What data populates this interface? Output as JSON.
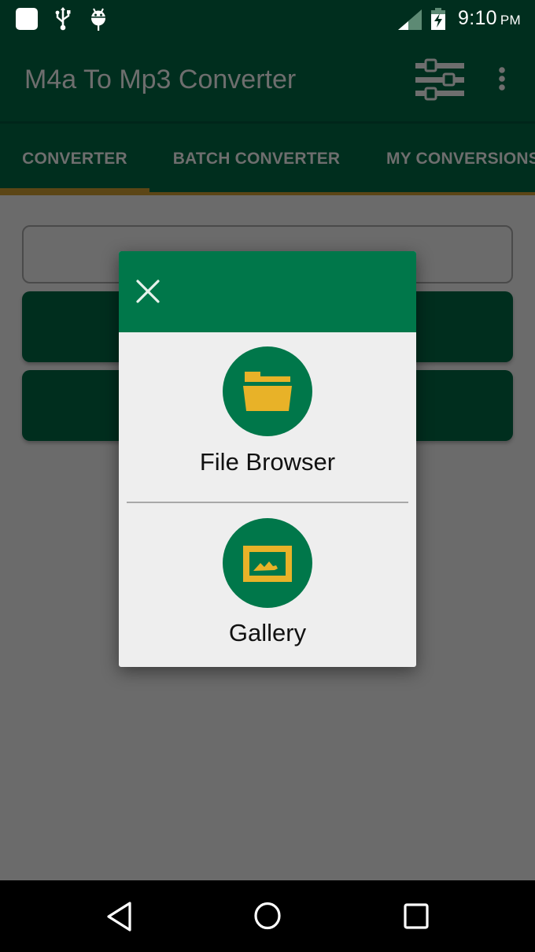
{
  "status_bar": {
    "time": "9:10",
    "ampm": "PM",
    "icons": [
      "notification-square-icon",
      "usb-icon",
      "android-debug-icon",
      "cell-signal-icon",
      "battery-charging-icon"
    ]
  },
  "app_bar": {
    "title": "M4a To Mp3 Converter",
    "actions": [
      "tune-icon",
      "more-vert-icon"
    ]
  },
  "tabs": [
    {
      "label": "CONVERTER",
      "active": true
    },
    {
      "label": "BATCH CONVERTER",
      "active": false
    },
    {
      "label": "MY CONVERSIONS",
      "active": false
    }
  ],
  "colors": {
    "primary_dark": "#002e1e",
    "dialog_green": "#00774a",
    "accent_yellow": "#e8b228",
    "tab_indicator": "#5c4616",
    "scrim_gray": "#6b6b6b"
  },
  "dialog": {
    "close_icon": "close-icon",
    "options": [
      {
        "label": "File Browser",
        "icon": "folder-open-icon"
      },
      {
        "label": "Gallery",
        "icon": "image-icon"
      }
    ]
  },
  "nav_bar": {
    "buttons": [
      "back-icon",
      "home-icon",
      "recents-icon"
    ]
  }
}
